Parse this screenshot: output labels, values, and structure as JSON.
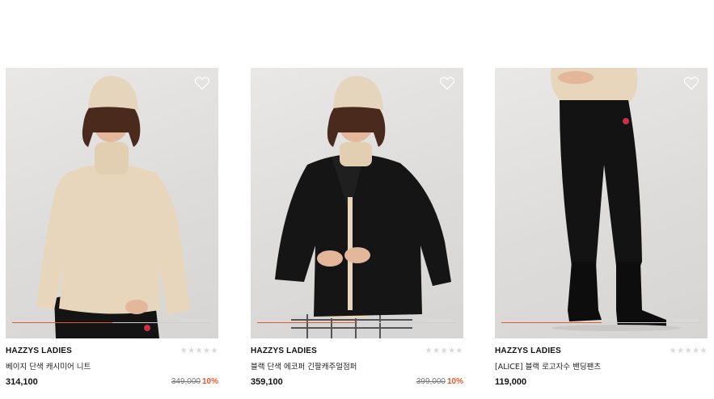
{
  "products": [
    {
      "brand": "HAZZYS LADIES",
      "name": "베이지 단색 캐시미어 니트",
      "price": "314,100",
      "original_price": "349,000",
      "discount": "10%",
      "rating_stars": "★★★★★",
      "rating": 0,
      "image_progress": 0.5
    },
    {
      "brand": "HAZZYS LADIES",
      "name": "블랙 단색 에코퍼 긴팔캐주얼점퍼",
      "price": "359,100",
      "original_price": "399,000",
      "discount": "10%",
      "rating_stars": "★★★★★",
      "rating": 0,
      "image_progress": 0.5
    },
    {
      "brand": "HAZZYS LADIES",
      "name": "[ALICE] 블랙 로고자수 밴딩팬츠",
      "price": "119,000",
      "rating_stars": "★★★★★",
      "rating": 0,
      "image_progress": 0.5
    }
  ],
  "colors": {
    "accent": "#e25a2c",
    "photo_bg": "#e0dfdd",
    "beige": "#e7d6bc",
    "black": "#111111"
  }
}
